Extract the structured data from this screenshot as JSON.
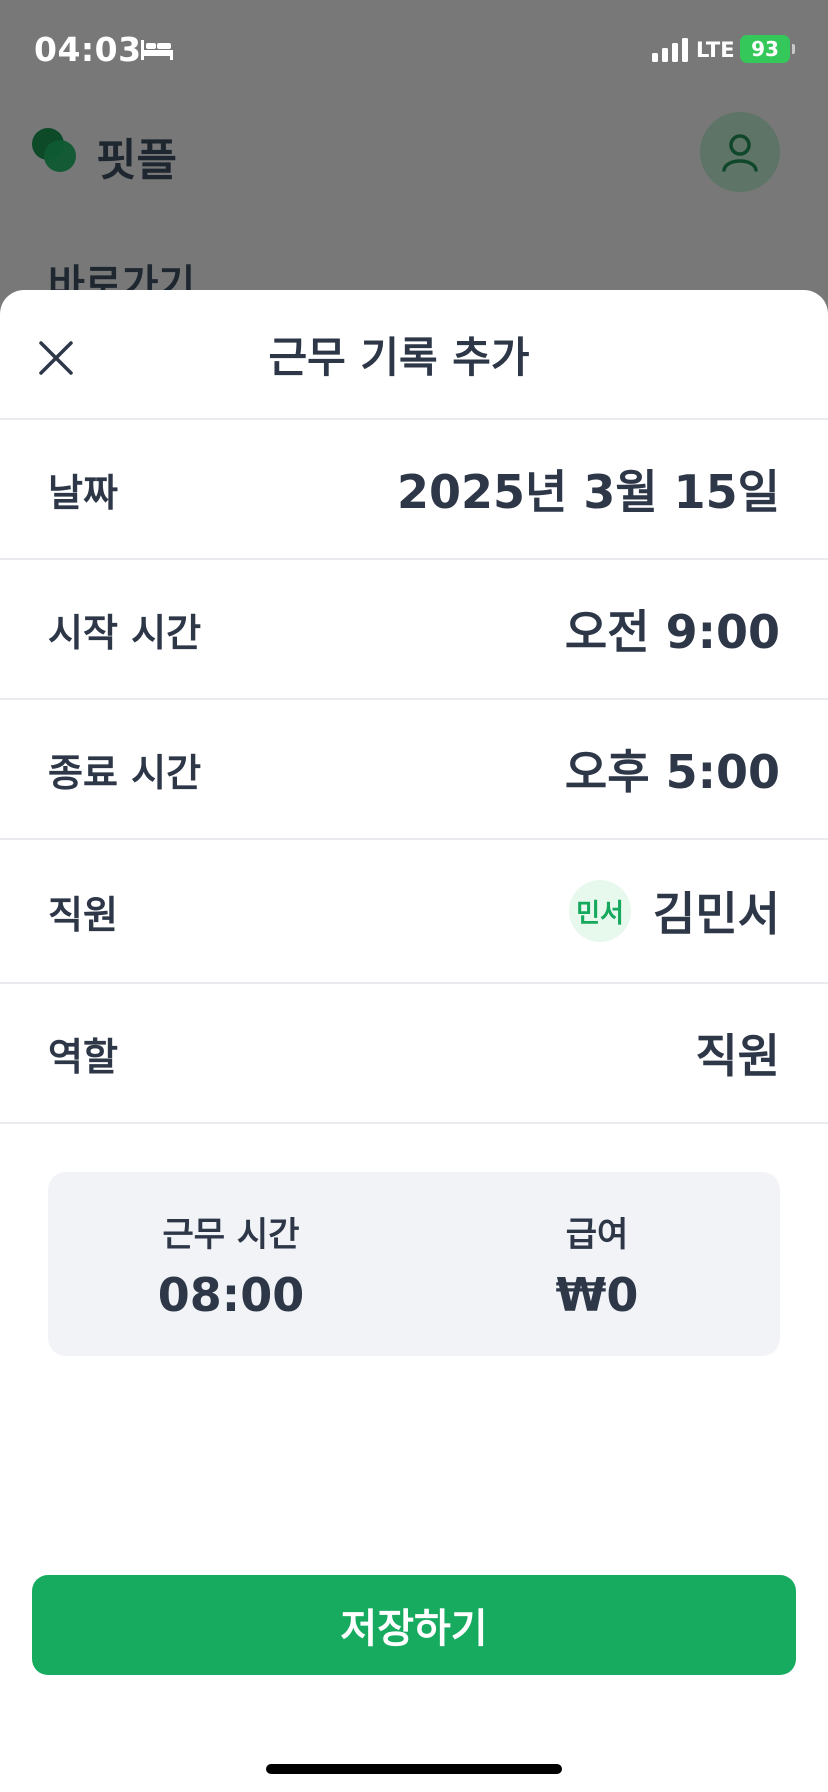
{
  "status_bar": {
    "time": "04:03",
    "network": "LTE",
    "battery": "93"
  },
  "app": {
    "name": "핏플",
    "shortcut_section": "바로가기"
  },
  "sheet": {
    "title": "근무 기록 추가",
    "rows": [
      {
        "label": "날짜",
        "value": "2025년 3월 15일"
      },
      {
        "label": "시작 시간",
        "value": "오전 9:00"
      },
      {
        "label": "종료 시간",
        "value": "오후 5:00"
      },
      {
        "label": "직원",
        "value": "김민서",
        "avatar": "민서"
      },
      {
        "label": "역할",
        "value": "직원"
      }
    ],
    "summary": {
      "hours_label": "근무 시간",
      "hours_value": "08:00",
      "pay_label": "급여",
      "pay_value": "₩0"
    },
    "save_label": "저장하기"
  },
  "colors": {
    "brand_green": "#17ab60",
    "avatar_bg": "#e7f8ed",
    "text_dark": "#2d3748",
    "card_bg": "#f1f3f7"
  }
}
